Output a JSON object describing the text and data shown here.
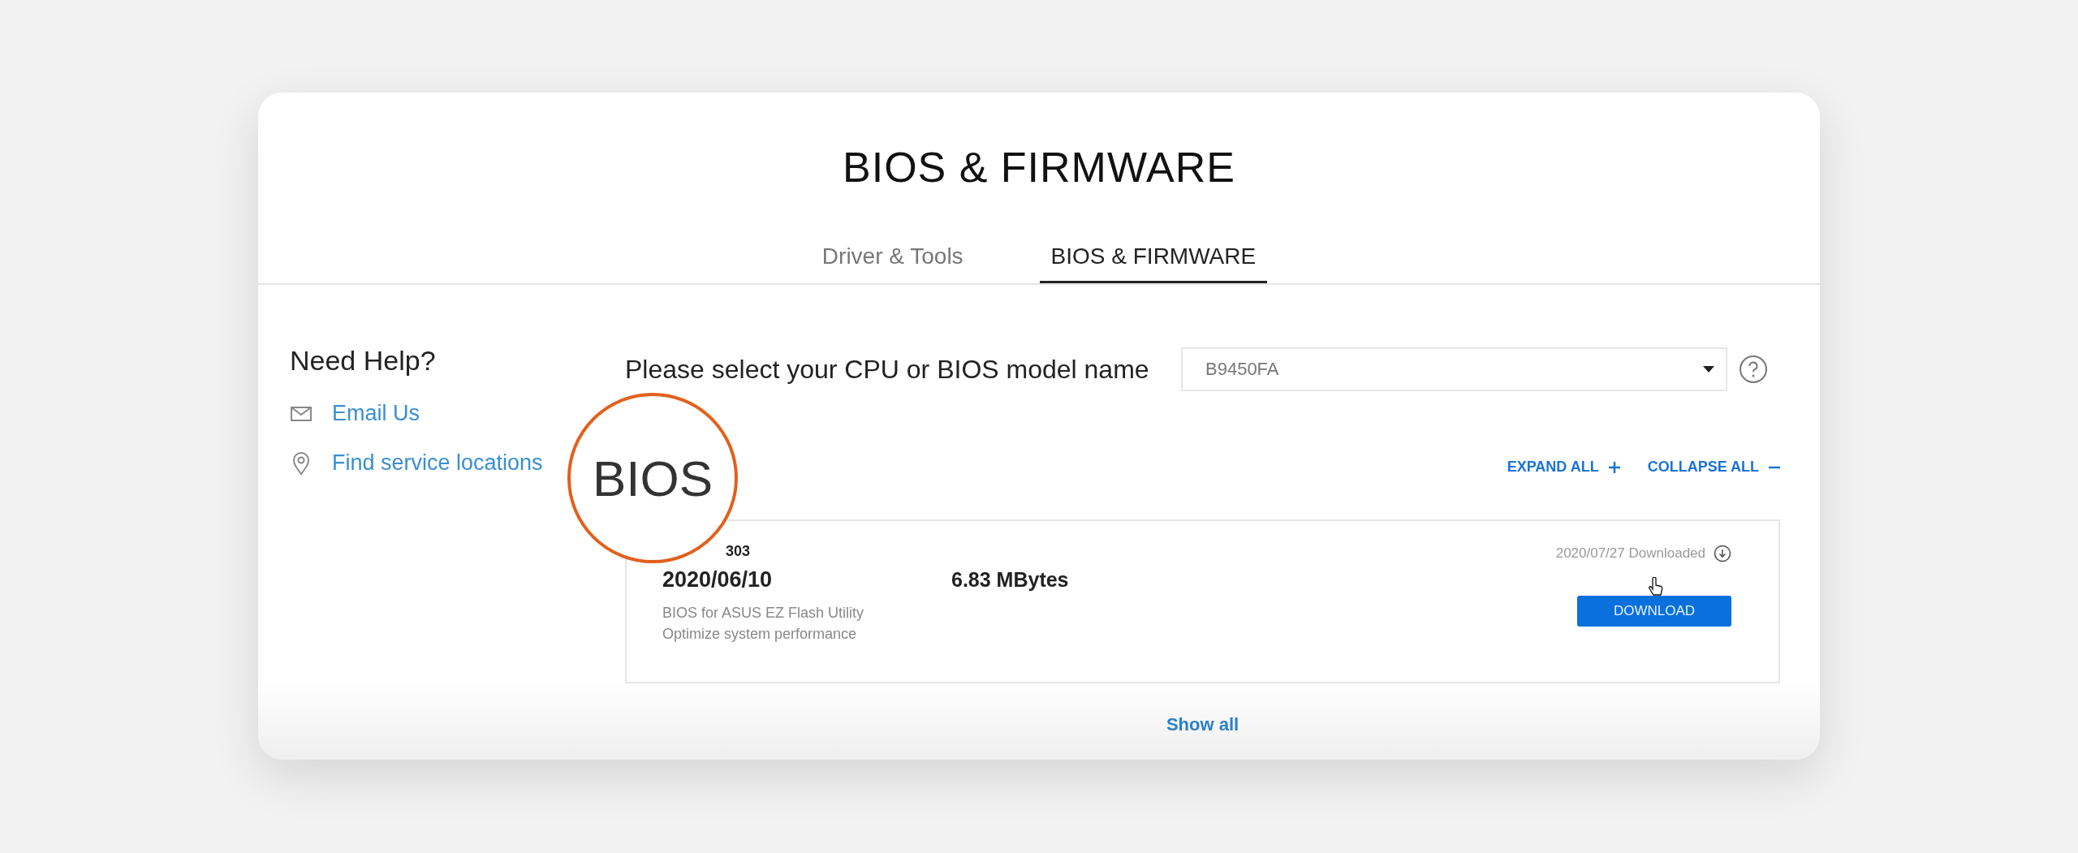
{
  "page_title": "BIOS & FIRMWARE",
  "tabs": [
    {
      "label": "Driver & Tools",
      "selected": false
    },
    {
      "label": "BIOS & FIRMWARE",
      "selected": true
    }
  ],
  "help": {
    "title": "Need Help?",
    "links": [
      {
        "kind": "email",
        "label": "Email Us"
      },
      {
        "kind": "location",
        "label": "Find service locations"
      }
    ]
  },
  "model_select": {
    "label": "Please select your CPU or BIOS model name",
    "value": "B9450FA"
  },
  "magnifier": {
    "text": "BIOS"
  },
  "expand_all": "EXPAND ALL",
  "collapse_all": "COLLAPSE ALL",
  "items": [
    {
      "version": "303",
      "date": "2020/06/10",
      "size": "6.83 MBytes",
      "description": [
        "BIOS for ASUS EZ Flash Utility",
        "Optimize system performance"
      ],
      "status": "2020/07/27 Downloaded",
      "button": "DOWNLOAD"
    }
  ],
  "show_all": "Show all"
}
